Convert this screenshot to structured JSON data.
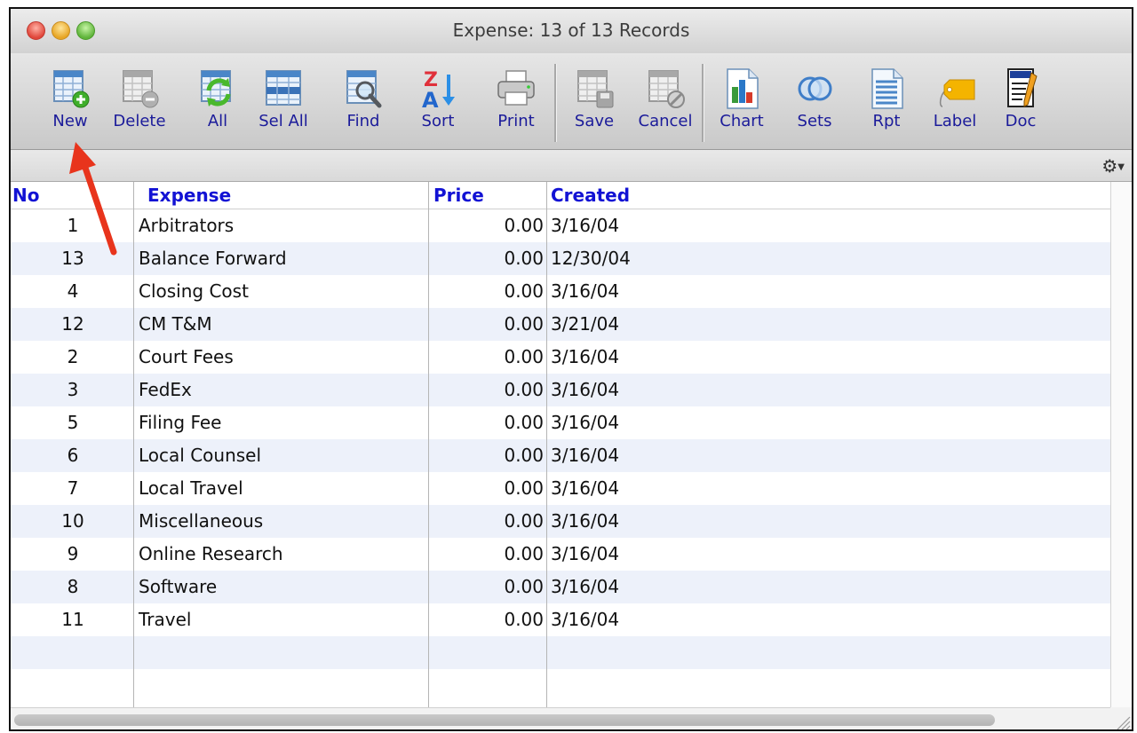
{
  "window": {
    "title": "Expense: 13 of 13 Records"
  },
  "toolbar": {
    "new": "New",
    "delete": "Delete",
    "all": "All",
    "sel_all": "Sel All",
    "find": "Find",
    "sort": "Sort",
    "print": "Print",
    "save": "Save",
    "cancel": "Cancel",
    "chart": "Chart",
    "sets": "Sets",
    "rpt": "Rpt",
    "label": "Label",
    "doc": "Doc"
  },
  "table": {
    "headers": {
      "no": "No",
      "expense": "Expense",
      "price": "Price",
      "created": "Created"
    },
    "rows": [
      {
        "no": "1",
        "expense": "Arbitrators",
        "price": "0.00",
        "created": "3/16/04"
      },
      {
        "no": "13",
        "expense": "Balance Forward",
        "price": "0.00",
        "created": "12/30/04"
      },
      {
        "no": "4",
        "expense": "Closing Cost",
        "price": "0.00",
        "created": "3/16/04"
      },
      {
        "no": "12",
        "expense": "CM T&M",
        "price": "0.00",
        "created": "3/21/04"
      },
      {
        "no": "2",
        "expense": "Court Fees",
        "price": "0.00",
        "created": "3/16/04"
      },
      {
        "no": "3",
        "expense": "FedEx",
        "price": "0.00",
        "created": "3/16/04"
      },
      {
        "no": "5",
        "expense": "Filing Fee",
        "price": "0.00",
        "created": "3/16/04"
      },
      {
        "no": "6",
        "expense": "Local Counsel",
        "price": "0.00",
        "created": "3/16/04"
      },
      {
        "no": "7",
        "expense": "Local Travel",
        "price": "0.00",
        "created": "3/16/04"
      },
      {
        "no": "10",
        "expense": "Miscellaneous",
        "price": "0.00",
        "created": "3/16/04"
      },
      {
        "no": "9",
        "expense": "Online Research",
        "price": "0.00",
        "created": "3/16/04"
      },
      {
        "no": "8",
        "expense": "Software",
        "price": "0.00",
        "created": "3/16/04"
      },
      {
        "no": "11",
        "expense": "Travel",
        "price": "0.00",
        "created": "3/16/04"
      }
    ]
  },
  "colors": {
    "header_text": "#1212d4",
    "label_text": "#1b1b9a",
    "alt_row": "#edf1fa",
    "annotation_arrow": "#e8341c"
  },
  "icons": [
    "new-icon",
    "delete-icon",
    "all-icon",
    "sel-all-icon",
    "find-icon",
    "sort-icon",
    "print-icon",
    "save-icon",
    "cancel-icon",
    "chart-icon",
    "sets-icon",
    "rpt-icon",
    "label-icon",
    "doc-icon",
    "gear-icon"
  ]
}
